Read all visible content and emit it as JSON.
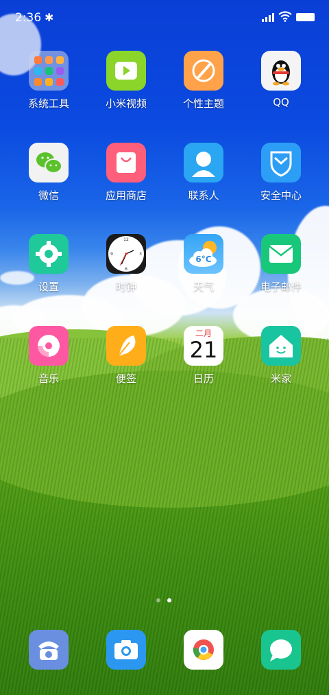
{
  "status_bar": {
    "time": "2:36",
    "bluetooth_icon": "bluetooth-icon"
  },
  "apps": [
    {
      "id": "system-tools",
      "label": "系统工具",
      "icon": "folder-icon"
    },
    {
      "id": "mi-video",
      "label": "小米视频",
      "icon": "play-icon"
    },
    {
      "id": "themes",
      "label": "个性主题",
      "icon": "brush-icon"
    },
    {
      "id": "qq",
      "label": "QQ",
      "icon": "penguin-icon"
    },
    {
      "id": "wechat",
      "label": "微信",
      "icon": "wechat-icon"
    },
    {
      "id": "app-store",
      "label": "应用商店",
      "icon": "shopping-bag-icon"
    },
    {
      "id": "contacts",
      "label": "联系人",
      "icon": "person-icon"
    },
    {
      "id": "security",
      "label": "安全中心",
      "icon": "shield-icon"
    },
    {
      "id": "settings",
      "label": "设置",
      "icon": "gear-icon"
    },
    {
      "id": "clock",
      "label": "时钟",
      "icon": "clock-icon"
    },
    {
      "id": "weather",
      "label": "天气",
      "icon": "weather-icon",
      "temp": "6°C"
    },
    {
      "id": "email",
      "label": "电子邮件",
      "icon": "envelope-icon"
    },
    {
      "id": "music",
      "label": "音乐",
      "icon": "music-disc-icon"
    },
    {
      "id": "notes",
      "label": "便签",
      "icon": "feather-icon"
    },
    {
      "id": "calendar",
      "label": "日历",
      "icon": "calendar-icon",
      "month": "二月",
      "day": "21"
    },
    {
      "id": "mi-home",
      "label": "米家",
      "icon": "house-icon"
    }
  ],
  "dock": [
    {
      "id": "phone",
      "icon": "phone-icon"
    },
    {
      "id": "camera",
      "icon": "camera-icon"
    },
    {
      "id": "browser",
      "icon": "browser-icon"
    },
    {
      "id": "messages",
      "icon": "message-icon"
    }
  ],
  "page_indicator": {
    "count": 2,
    "active": 1
  }
}
